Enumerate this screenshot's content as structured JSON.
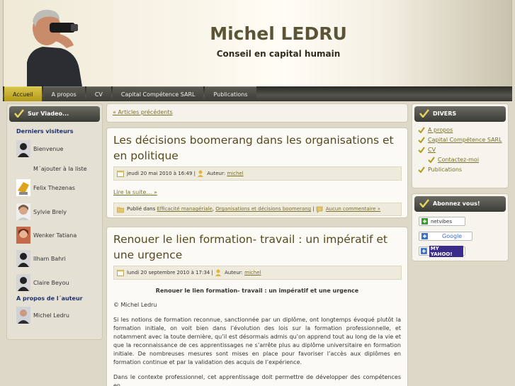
{
  "header": {
    "title": "Michel LEDRU",
    "description": "Conseil en capital humain"
  },
  "nav": {
    "tabs": [
      {
        "label": "Accueil",
        "active": true
      },
      {
        "label": "A propos"
      },
      {
        "label": "CV"
      },
      {
        "label": "Capital Compétence SARL"
      },
      {
        "label": "Publications"
      }
    ]
  },
  "left_sidebar": {
    "widget_title": "Sur Viadeo...",
    "visitors_heading": "Derniers visiteurs",
    "visitors": [
      {
        "name": "Bienvenue"
      },
      {
        "name": "M´ajouter à la liste"
      },
      {
        "name": "Felix Thezenas"
      },
      {
        "name": "Sylvie Brely"
      },
      {
        "name": "Wenker Tatiana"
      },
      {
        "name": "Ilham Bahri"
      },
      {
        "name": "Claire Beyou"
      }
    ],
    "author_heading": "A propos de l´auteur",
    "author_name": "Michel Ledru"
  },
  "main": {
    "older_posts": "« Articles précédents",
    "posts": [
      {
        "title": "Les décisions boomerang dans les organisations et en politique",
        "date": "jeudi 20 mai 2010 à 16:49",
        "author_label": "Auteur:",
        "author": "michel",
        "read_more": "Lire la suite… »",
        "published_in": "Publié dans",
        "categories": [
          "Efficacité managériale",
          "Organisations et décisions boomerang"
        ],
        "comments": "Aucun commentaire »"
      },
      {
        "title": "Renouer le lien formation- travail : un impératif et une urgence",
        "date": "lundi 20 septembre 2010 à 17:34",
        "author_label": "Auteur:",
        "author": "michel",
        "subheading": "Renouer le lien formation- travail : un impératif et une urgence",
        "copyright": "© Michel Ledru",
        "paragraph1": "Si les notions de formation reconnue, sanctionnée par un diplôme, ont longtemps évoqué plutôt la formation initiale, on voit bien dans l’évolution des lois sur la formation professionnelle, et notamment avec la toute dernière, qu’il est désormais admis qu’on apprend tout au long de la vie et que la reconnaissance de ces apprentissages ne s’arrête plus au diplôme universitaire en formation initiale. De nombreuses mesures sont mises en place pour favoriser l’accès aux diplômes en formation continue et par la validation des acquis de l’expérience.",
        "paragraph2": "Dans le contexte professionnel, cet apprentissage doit permettre de développer des compétences en"
      }
    ]
  },
  "right_sidebar": {
    "divers_title": "DIVERS",
    "divers_items": [
      {
        "label": "A propos"
      },
      {
        "label": "Capital Compétence SARL"
      },
      {
        "label": "CV"
      },
      {
        "label": "Contactez-moi",
        "child": true
      },
      {
        "label": "Publications"
      }
    ],
    "subscribe_title": "Abonnez vous!",
    "subscribe": [
      "netvibes",
      "Google",
      "MY YAHOO!"
    ]
  },
  "colors": {
    "accent": "#b39a19",
    "link": "#7b6f2e",
    "title": "#57491f"
  }
}
